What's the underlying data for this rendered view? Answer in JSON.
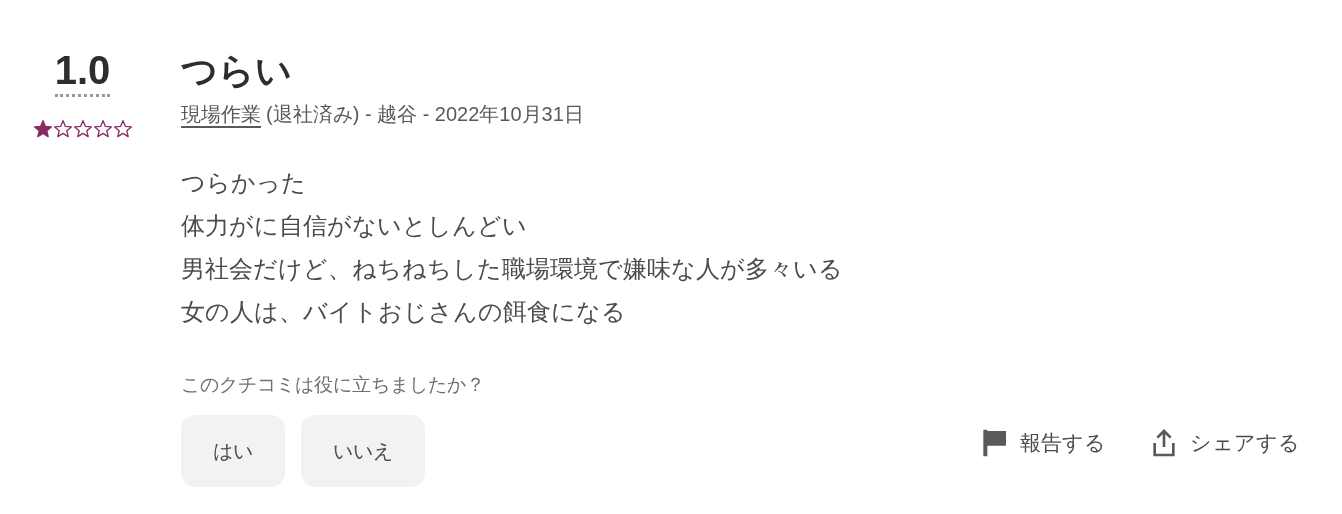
{
  "review": {
    "rating": "1.0",
    "stars": 1,
    "title": "つらい",
    "job": "現場作業",
    "meta_suffix": "(退社済み) - 越谷 - 2022年10月31日",
    "body": [
      "つらかった",
      "体力がに自信がないとしんどい",
      "男社会だけど、ねちねちした職場環境で嫌味な人が多々いる",
      "女の人は、バイトおじさんの餌食になる"
    ],
    "helpful_question": "このクチコミは役に立ちましたか？",
    "votes": [
      {
        "label": "はい"
      },
      {
        "label": "いいえ"
      }
    ],
    "actions": [
      {
        "kind": "report",
        "label": "報告する"
      },
      {
        "kind": "share",
        "label": "シェアする"
      }
    ]
  }
}
